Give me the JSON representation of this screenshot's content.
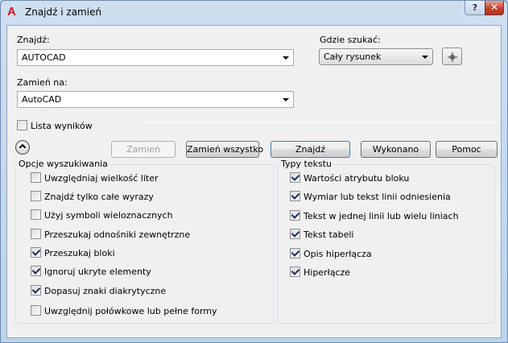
{
  "window": {
    "title": "Znajdź i zamień",
    "help_label": "?",
    "close_label": "✕"
  },
  "find": {
    "label": "Znajdź:",
    "value": "AUTOCAD"
  },
  "replace": {
    "label": "Zamień na:",
    "value": "AutoCAD"
  },
  "where": {
    "label": "Gdzie szukać:",
    "value": "Cały rysunek"
  },
  "results_list": {
    "label": "Lista wyników",
    "checked": false
  },
  "buttons": {
    "replace": "Zamień",
    "replace_all": "Zamień wszystko",
    "find": "Znajdź",
    "done": "Wykonano",
    "help": "Pomoc"
  },
  "search_options": {
    "title": "Opcje wyszukiwania",
    "items": [
      {
        "label": "Uwzględniaj wielkość liter",
        "checked": false
      },
      {
        "label": "Znajdź tylko całe wyrazy",
        "checked": false
      },
      {
        "label": "Użyj symboli wieloznacznych",
        "checked": false
      },
      {
        "label": "Przeszukaj odnośniki zewnętrzne",
        "checked": false
      },
      {
        "label": "Przeszukaj bloki",
        "checked": true
      },
      {
        "label": "Ignoruj ukryte elementy",
        "checked": true
      },
      {
        "label": "Dopasuj znaki diakrytyczne",
        "checked": true
      },
      {
        "label": "Uwzględnij połówkowe lub pełne formy",
        "checked": false
      }
    ]
  },
  "text_types": {
    "title": "Typy tekstu",
    "items": [
      {
        "label": "Wartości atrybutu bloku",
        "checked": true
      },
      {
        "label": "Wymiar lub tekst linii odniesienia",
        "checked": true
      },
      {
        "label": "Tekst w jednej linii lub wielu liniach",
        "checked": true
      },
      {
        "label": "Tekst tabeli",
        "checked": true
      },
      {
        "label": "Opis hiperłącza",
        "checked": true
      },
      {
        "label": "Hiperłącze",
        "checked": true
      }
    ]
  }
}
